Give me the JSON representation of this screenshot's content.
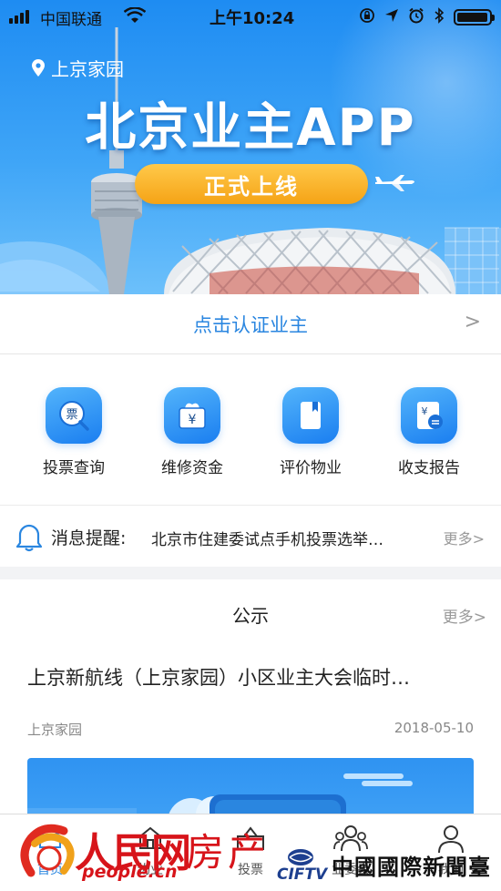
{
  "status_bar": {
    "carrier": "中国联通",
    "time": "上午10:24"
  },
  "banner": {
    "location": "上京家园",
    "title": "北京业主APP",
    "badge": "正式上线"
  },
  "verify": {
    "label": "点击认证业主",
    "arrow": ">"
  },
  "quick_menu": [
    {
      "label": "投票查询",
      "icon": "ticket-search-icon",
      "glyph": "票"
    },
    {
      "label": "维修资金",
      "icon": "money-bag-icon",
      "glyph": "¥"
    },
    {
      "label": "评价物业",
      "icon": "book-icon",
      "glyph": ""
    },
    {
      "label": "收支报告",
      "icon": "report-icon",
      "glyph": "¥"
    }
  ],
  "notice": {
    "title": "消息提醒:",
    "text": "北京市住建委试点手机投票选举…",
    "more": "更多>"
  },
  "announcement": {
    "title": "公示",
    "more": "更多>",
    "article": {
      "headline": "上京新航线（上京家园）小区业主大会临时…",
      "source": "上京家园",
      "date": "2018-05-10"
    }
  },
  "tabbar": [
    {
      "label": "首页",
      "icon": "home-icon",
      "active": true
    },
    {
      "label": "物业",
      "icon": "building-icon",
      "active": false
    },
    {
      "label": "投票",
      "icon": "ballot-icon",
      "active": false
    },
    {
      "label": "业委会",
      "icon": "group-icon",
      "active": false
    },
    {
      "label": "我的",
      "icon": "user-icon",
      "active": false
    }
  ],
  "watermark": {
    "people_cn": "人民网",
    "people_en": "people.cn",
    "section": "房产",
    "cictv": "CIFTV",
    "cn_name": "中國國際新聞臺"
  },
  "colors": {
    "brand_blue": "#2a86e0",
    "badge_orange": "#f5a316",
    "watermark_red": "#d7141a"
  }
}
